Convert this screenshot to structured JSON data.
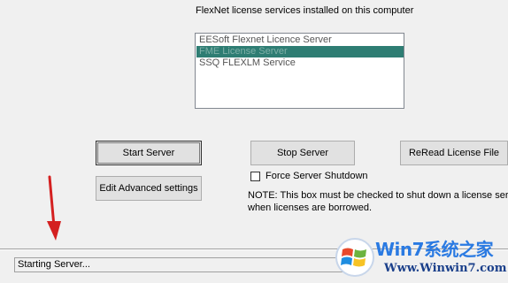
{
  "header": {
    "title": "FlexNet license services installed on this computer"
  },
  "services_list": {
    "items": [
      {
        "label": "EESoft Flexnet Licence Server",
        "selected": false
      },
      {
        "label": "FME License Server",
        "selected": true
      },
      {
        "label": "SSQ FLEXLM Service",
        "selected": false
      }
    ]
  },
  "buttons": {
    "start_label": "Start Server",
    "stop_label": "Stop Server",
    "reread_label": "ReRead License File",
    "edit_advanced_label": "Edit Advanced settings"
  },
  "force_shutdown": {
    "label": "Force Server Shutdown",
    "checked": false
  },
  "note": {
    "line1": "NOTE:  This box must be checked to shut down a license serv",
    "line2": "when licenses are borrowed."
  },
  "status": {
    "text": "Starting Server..."
  },
  "watermark": {
    "title": "Win7系统之家",
    "url": "Www.Winwin7.com"
  },
  "colors": {
    "selection": "#2e7d73",
    "arrow": "#d42020",
    "watermark_blue": "#2a7ae2"
  },
  "icons": {
    "annotation_arrow": "red-arrow-icon",
    "watermark_logo": "windows-logo-icon"
  }
}
